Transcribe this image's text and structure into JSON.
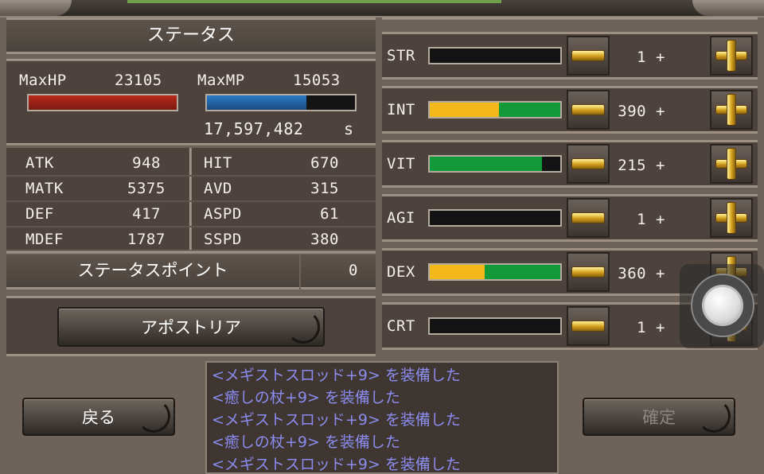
{
  "header": {
    "title": "ステータス"
  },
  "hpmp": {
    "maxhp_label": "MaxHP",
    "maxhp_value": "23105",
    "maxmp_label": "MaxMP",
    "maxmp_value": "15053",
    "money": "17,597,482",
    "money_unit": "s",
    "hp_fill": 1.0,
    "mp_fill": 0.67
  },
  "stats": [
    {
      "label": "ATK",
      "value": "948"
    },
    {
      "label": "HIT",
      "value": "670"
    },
    {
      "label": "MATK",
      "value": "5375"
    },
    {
      "label": "AVD",
      "value": "315"
    },
    {
      "label": "DEF",
      "value": "417"
    },
    {
      "label": "ASPD",
      "value": "61"
    },
    {
      "label": "MDEF",
      "value": "1787"
    },
    {
      "label": "SSPD",
      "value": "380"
    }
  ],
  "points": {
    "label": "ステータスポイント",
    "value": "0"
  },
  "apostoria_button": "アポストリア",
  "attributes": [
    {
      "label": "STR",
      "value": "1 +",
      "yellow": 0,
      "green": 0
    },
    {
      "label": "INT",
      "value": "390 +",
      "yellow": 0.53,
      "green": 0.47
    },
    {
      "label": "VIT",
      "value": "215 +",
      "yellow": 0,
      "green": 0.86
    },
    {
      "label": "AGI",
      "value": "1 +",
      "yellow": 0,
      "green": 0
    },
    {
      "label": "DEX",
      "value": "360 +",
      "yellow": 0.42,
      "green": 0.58
    },
    {
      "label": "CRT",
      "value": "1 +",
      "yellow": 0,
      "green": 0
    }
  ],
  "back_button": "戻る",
  "confirm_button": "確定",
  "log": [
    "<メギストスロッド+9> を装備した",
    "<癒しの杖+9> を装備した",
    "<メギストスロッド+9> を装備した",
    "<癒しの杖+9> を装備した",
    "<メギストスロッド+9> を装備した"
  ],
  "colors": {
    "hp": "#b82a1c",
    "mp": "#2a7ac6",
    "yellow": "#f2b81a",
    "green": "#129a3a",
    "log_text": "#8a8cf0",
    "disabled_text": "#8d857d"
  }
}
